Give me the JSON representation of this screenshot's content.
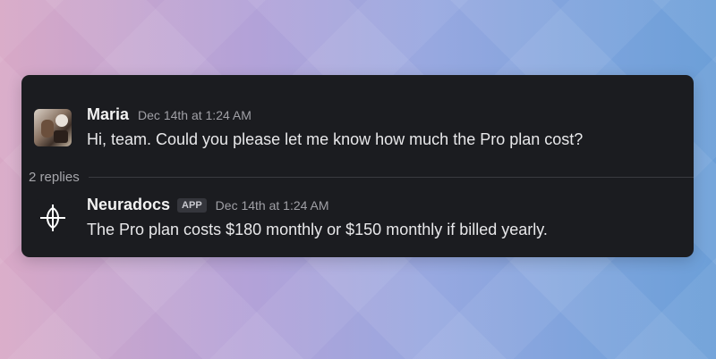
{
  "messages": [
    {
      "author": "Maria",
      "timestamp": "Dec 14th at 1:24 AM",
      "text": "Hi, team. Could you please let me know how much the Pro plan cost?"
    },
    {
      "author": "Neuradocs",
      "badge": "APP",
      "timestamp": "Dec 14th at 1:24 AM",
      "text": "The Pro plan costs $180 monthly or $150 monthly if billed yearly."
    }
  ],
  "thread": {
    "replies_label": "2 replies"
  },
  "icons": {
    "app_logo": "neuradocs-logo-icon"
  },
  "colors": {
    "panel": "#1b1c20",
    "text": "#e8e8ea",
    "muted": "#a0a0a6"
  }
}
